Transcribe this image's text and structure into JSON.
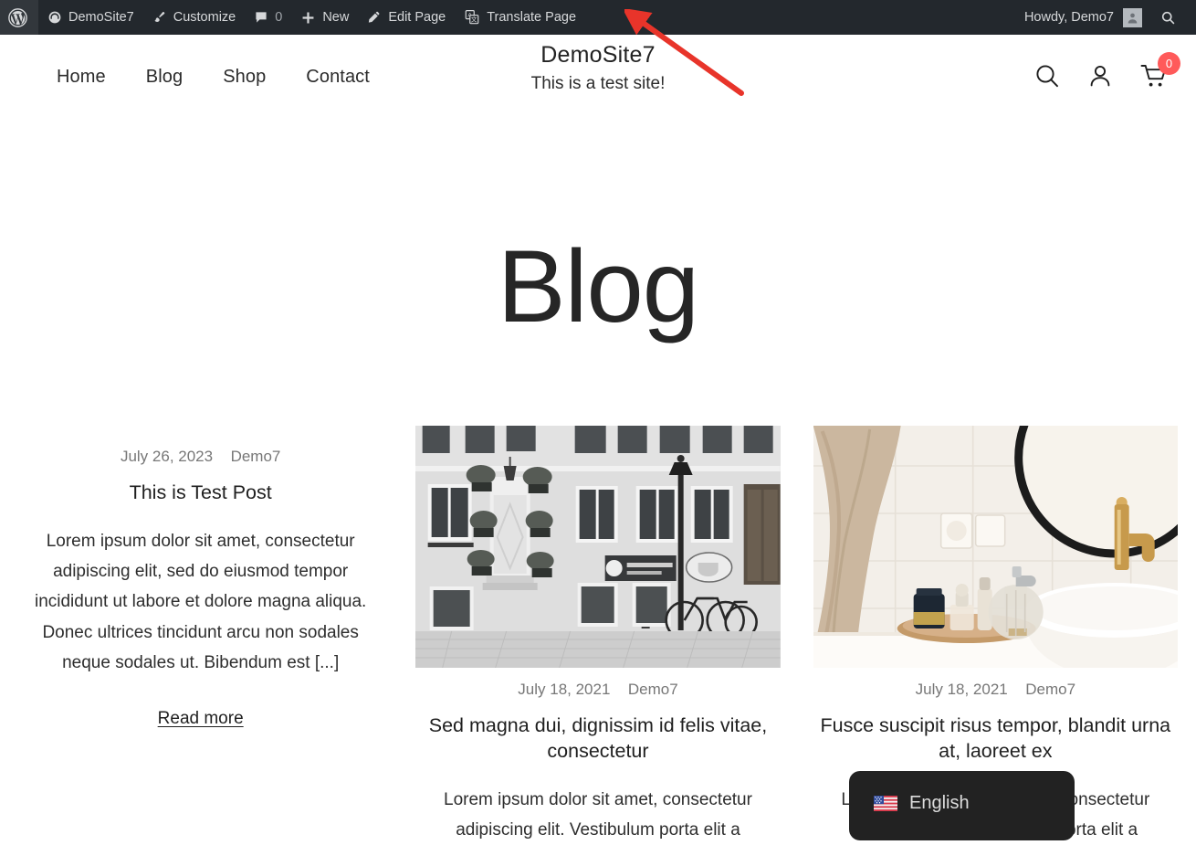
{
  "adminbar": {
    "wp_logo_icon": "wordpress-logo-icon",
    "items": [
      {
        "label": "DemoSite7",
        "icon": "dashboard-icon"
      },
      {
        "label": "Customize",
        "icon": "paintbrush-icon"
      },
      {
        "label": "0",
        "icon": "comment-bubble-icon"
      },
      {
        "label": "New",
        "icon": "plus-icon"
      },
      {
        "label": "Edit Page",
        "icon": "pencil-icon"
      },
      {
        "label": "Translate Page",
        "icon": "translate-icon"
      }
    ],
    "howdy": "Howdy, Demo7",
    "avatar_icon": "user-avatar-icon",
    "search_icon": "search-icon"
  },
  "header": {
    "nav": [
      {
        "label": "Home"
      },
      {
        "label": "Blog"
      },
      {
        "label": "Shop"
      },
      {
        "label": "Contact"
      }
    ],
    "site_title": "DemoSite7",
    "tagline": "This is a test site!",
    "tools": {
      "search_icon": "search-icon",
      "account_icon": "user-account-icon",
      "cart_icon": "shopping-cart-icon",
      "cart_count": "0",
      "cart_badge_color": "#ff5a5a"
    }
  },
  "main": {
    "page_title": "Blog",
    "posts": [
      {
        "date": "July 26, 2023",
        "author": "Demo7",
        "title": "This is Test Post",
        "excerpt": "Lorem ipsum dolor sit amet, consectetur adipiscing elit, sed do eiusmod tempor incididunt ut labore et dolore magna aliqua. Donec ultrices tincidunt arcu non sodales neque sodales ut. Bibendum est [...]",
        "read_more": "Read more",
        "has_image": false
      },
      {
        "date": "July 18, 2021",
        "author": "Demo7",
        "title": "Sed magna dui, dignissim id felis vitae, consectetur",
        "excerpt": "Lorem ipsum dolor sit amet, consectetur adipiscing elit. Vestibulum porta elit a",
        "has_image": true,
        "image_alt": "black-and-white-street-building-facade-with-bicycles"
      },
      {
        "date": "July 18, 2021",
        "author": "Demo7",
        "title": "Fusce suscipit risus tempor, blandit urna at, laoreet ex",
        "excerpt": "Lorem ipsum dolor sit amet, consectetur adipiscing elit. Vestibulum porta elit a",
        "has_image": true,
        "image_alt": "bathroom-sink-with-towel-and-toiletries"
      }
    ]
  },
  "language_switcher": {
    "label": "English",
    "flag_icon": "us-flag-icon"
  },
  "annotation": {
    "arrow_color": "#e8342a",
    "points_to": "Translate Page"
  }
}
